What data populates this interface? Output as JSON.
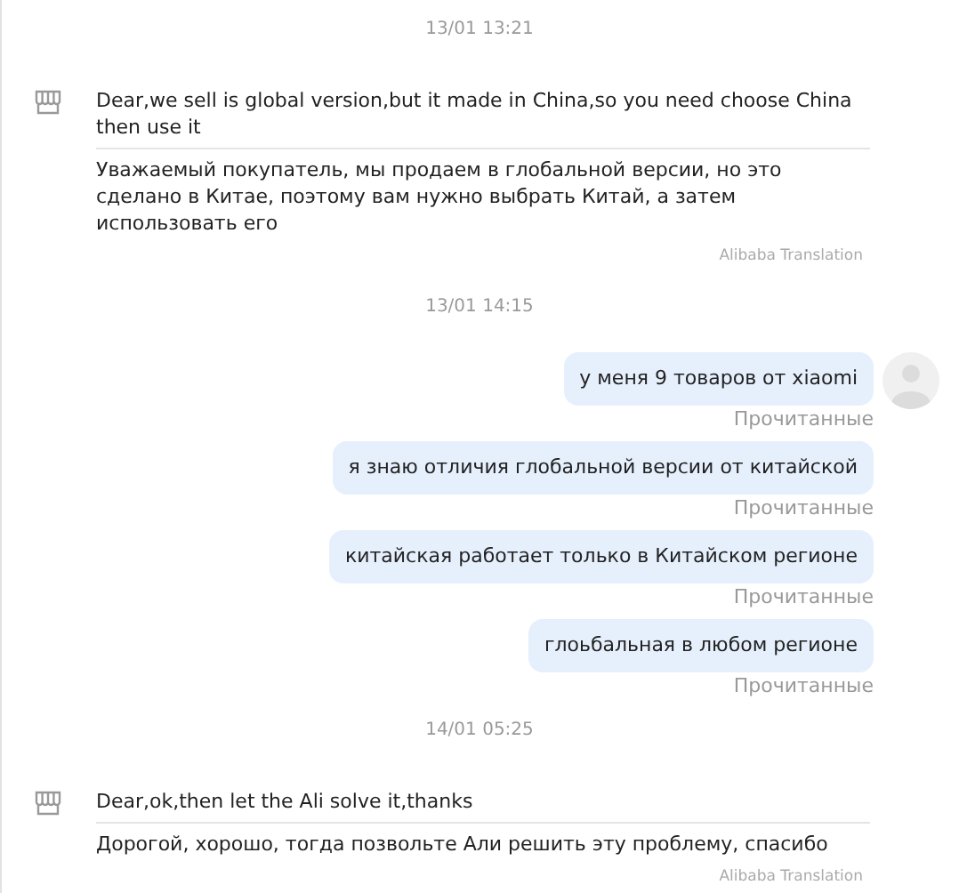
{
  "messages": [
    {
      "kind": "time",
      "text": "13/01 13:21"
    },
    {
      "kind": "incoming",
      "text": "Dear,we sell is global version,but it made in China,so you need choose China then use it",
      "translation": "Уважаемый покупатель, мы продаем в глобальной версии, но это сделано в Китае, поэтому вам нужно выбрать Китай, а затем использовать его",
      "source": "Alibaba Translation"
    },
    {
      "kind": "time",
      "text": "13/01 14:15"
    },
    {
      "kind": "outgoing",
      "text": "у меня 9 товаров от xiaomi",
      "status": "Прочитанные",
      "avatar": true
    },
    {
      "kind": "outgoing",
      "text": "я знаю отличия глобальной версии от китайской",
      "status": "Прочитанные"
    },
    {
      "kind": "outgoing",
      "text": "китайская работает только в Китайском регионе",
      "status": "Прочитанные"
    },
    {
      "kind": "outgoing",
      "text": "глоьбальная в любом регионе",
      "status": "Прочитанные"
    },
    {
      "kind": "time",
      "text": "14/01 05:25"
    },
    {
      "kind": "incoming",
      "text": "Dear,ok,then let the Ali solve it,thanks",
      "translation": "Дорогой, хорошо, тогда позвольте Али решить эту проблему, спасибо",
      "source": "Alibaba Translation"
    }
  ]
}
